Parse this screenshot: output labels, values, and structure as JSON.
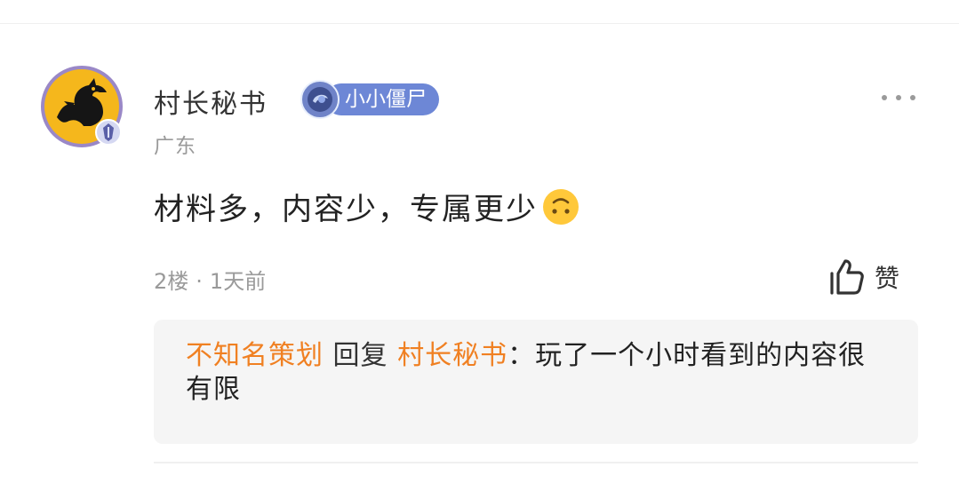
{
  "post": {
    "username": "村长秘书",
    "title_badge": "小小僵尸",
    "location": "广东",
    "content": "材料多，内容少，专属更少",
    "emoji": "upside-down-face-emoji",
    "floor": "2楼",
    "separator": "·",
    "time": "1天前",
    "like_label": "赞"
  },
  "reply": {
    "from_user": "不知名策划",
    "verb": "回复",
    "to_user": "村长秘书",
    "colon": "：",
    "text": "玩了一个小时看到的内容很有限"
  },
  "colors": {
    "reply_user": "#f08022",
    "badge_bg": "#6d87d6",
    "avatar_bg": "#f5b71c",
    "avatar_ring": "#9a88c7",
    "reply_bg": "#f5f5f5"
  },
  "icons": [
    "dragon-avatar-icon",
    "level-badge-icon",
    "more-icon",
    "emoji-icon",
    "thumbs-up-icon"
  ]
}
